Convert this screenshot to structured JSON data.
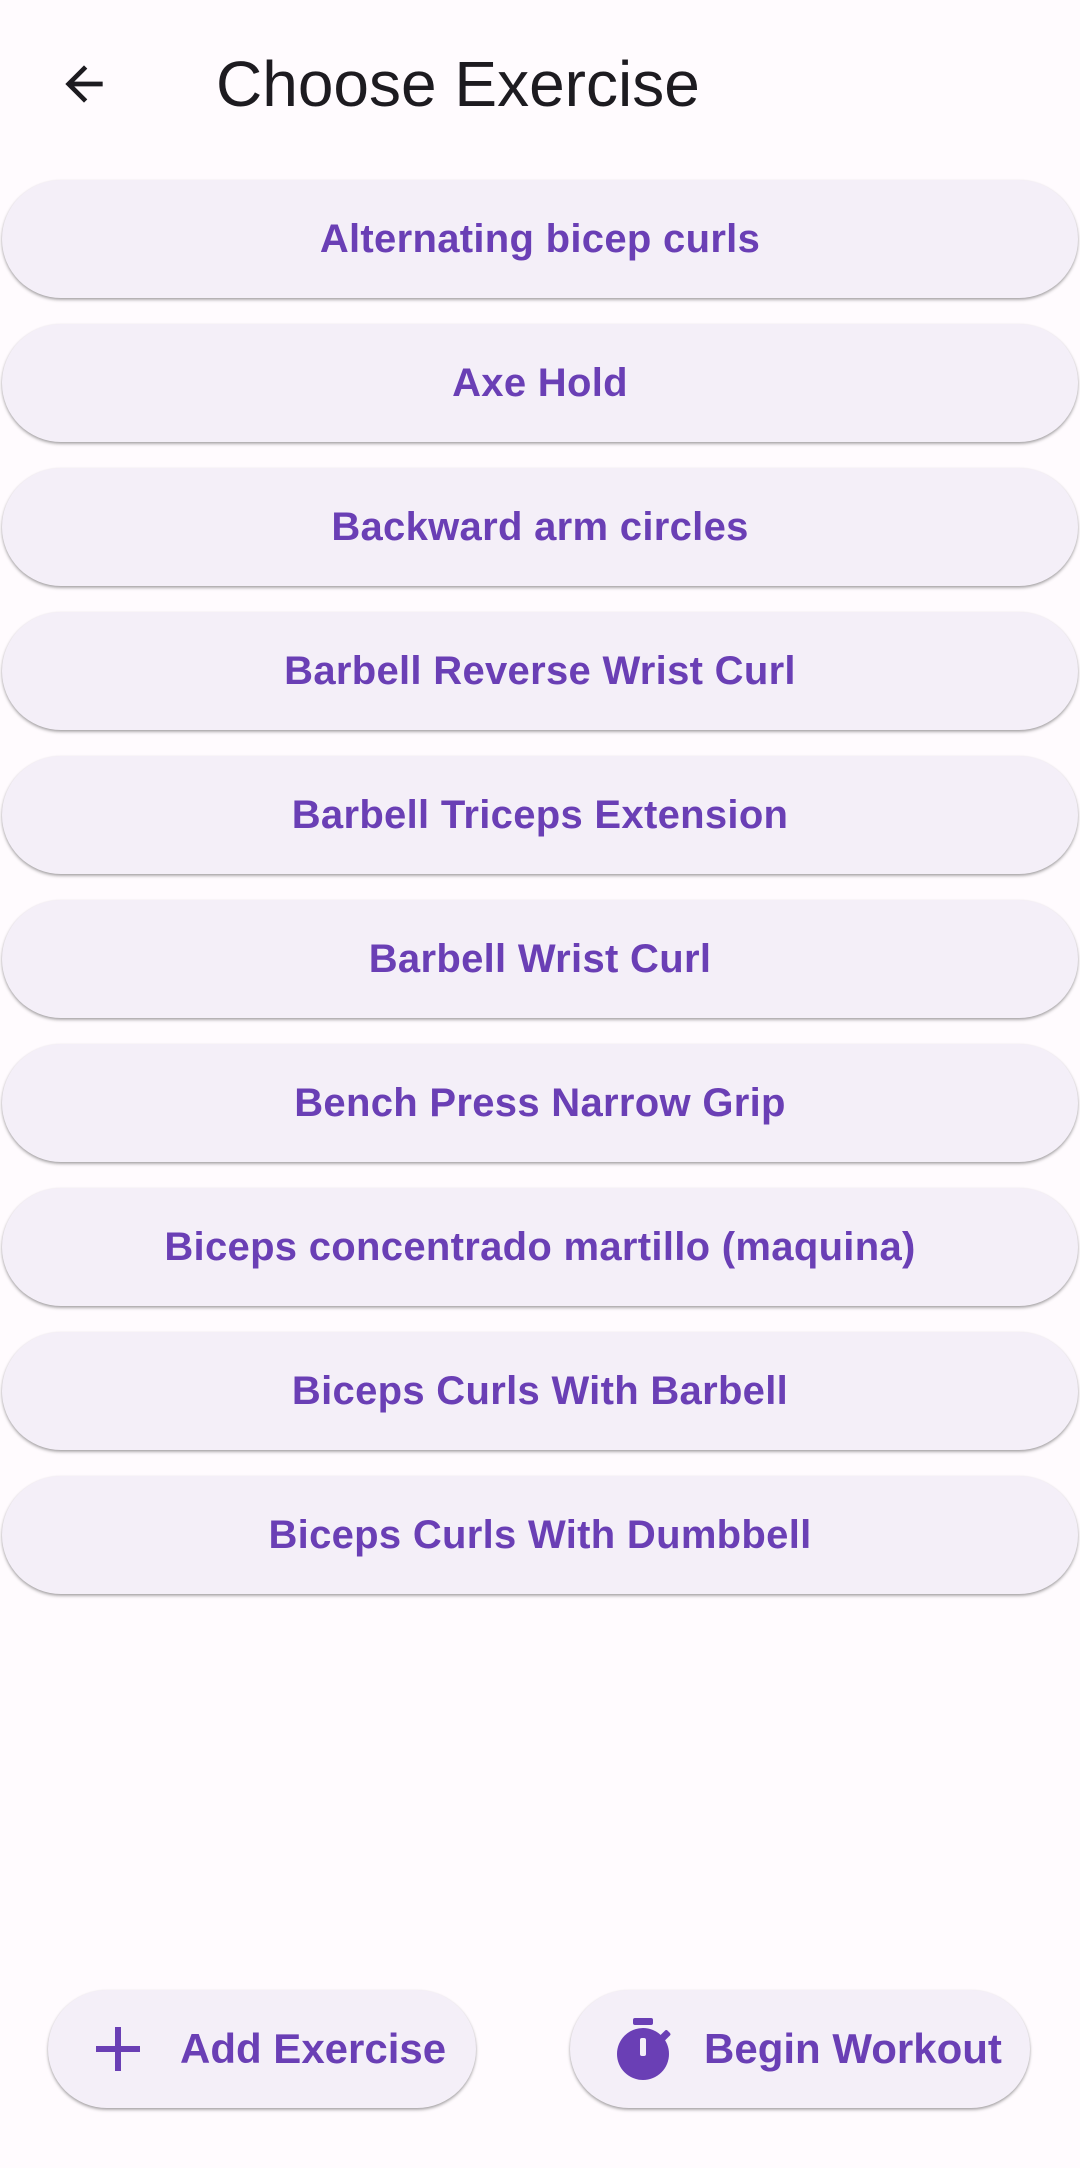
{
  "header": {
    "title": "Choose Exercise",
    "back_icon": "arrow-back-icon"
  },
  "exercises": [
    "Alternating bicep curls",
    "Axe Hold",
    "Backward arm circles",
    "Barbell Reverse Wrist Curl",
    "Barbell Triceps Extension",
    "Barbell Wrist Curl",
    "Bench Press Narrow Grip",
    "Biceps concentrado martillo (maquina)",
    "Biceps Curls With Barbell",
    "Biceps Curls With Dumbbell"
  ],
  "actions": {
    "add_exercise": {
      "label": "Add Exercise",
      "icon": "plus-icon"
    },
    "begin_workout": {
      "label": "Begin Workout",
      "icon": "stopwatch-icon"
    }
  },
  "colors": {
    "accent": "#6a3fb5",
    "button_bg": "#f4eff8",
    "page_bg": "#fffbfe",
    "title_text": "#1d1b20"
  }
}
